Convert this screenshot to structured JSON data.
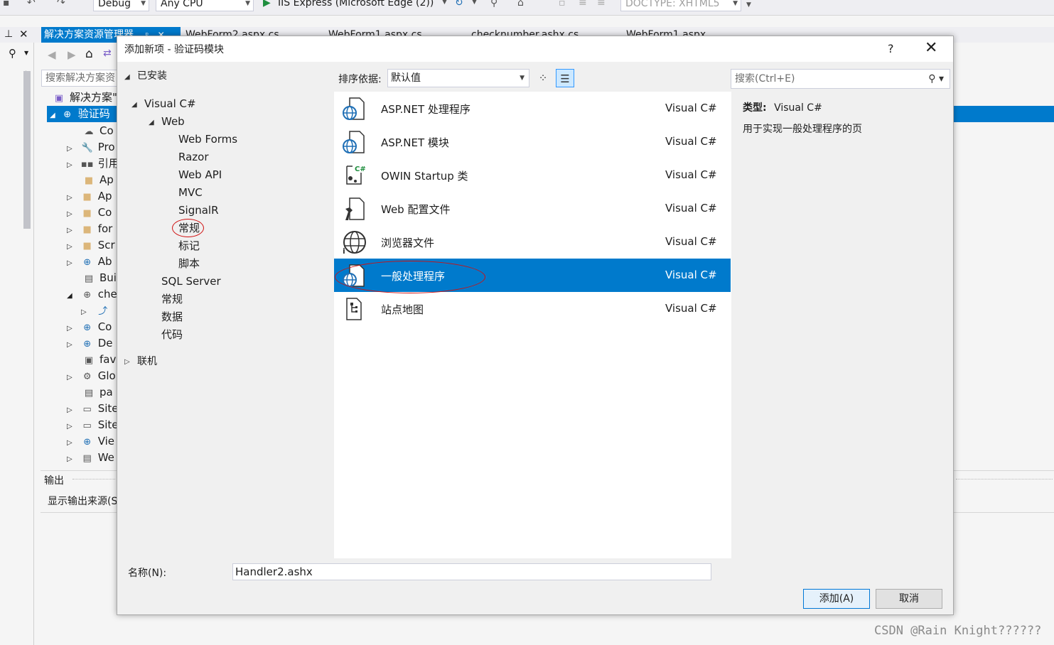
{
  "toolbar": {
    "config": "Debug",
    "platform": "Any CPU",
    "run_target": "IIS Express (Microsoft Edge (2))",
    "doctype": "DOCTYPE: XHTML5"
  },
  "doc_tabs": {
    "solution_explorer": "解决方案资源管理器",
    "tab1": "WebForm2.aspx.cs",
    "tab2": "WebForm1.aspx.cs",
    "tab3": "checknumber.ashx.cs",
    "tab4": "WebForm1.aspx"
  },
  "solution_explorer": {
    "search_placeholder": "搜索解决方案资",
    "solution_label": "解决方案\"",
    "project_label": "验证码",
    "items": [
      "Co",
      "Pro",
      "引用",
      "Ap",
      "Ap",
      "Co",
      "for",
      "Scr",
      "Ab",
      "Bui",
      "che",
      "",
      "Co",
      "De",
      "fav",
      "Glo",
      "pa",
      "Site",
      "Site",
      "Vie",
      "We"
    ]
  },
  "output": {
    "title": "输出",
    "source_label": "显示输出来源(S"
  },
  "dialog": {
    "title": "添加新项 - 验证码模块",
    "help": "?",
    "close": "✕",
    "tree": {
      "installed": "已安装",
      "visual_csharp": "Visual C#",
      "web": "Web",
      "web_forms": "Web Forms",
      "razor": "Razor",
      "web_api": "Web API",
      "mvc": "MVC",
      "signalr": "SignalR",
      "general_web": "常规",
      "markup": "标记",
      "script": "脚本",
      "sql_server": "SQL Server",
      "general": "常规",
      "data": "数据",
      "code": "代码",
      "online": "联机"
    },
    "sort_label": "排序依据:",
    "sort_value": "默认值",
    "search_placeholder": "搜索(Ctrl+E)",
    "templates": [
      {
        "name": "ASP.NET 处理程序",
        "lang": "Visual C#",
        "icon": "globe-doc-icon"
      },
      {
        "name": "ASP.NET 模块",
        "lang": "Visual C#",
        "icon": "globe-doc-icon"
      },
      {
        "name": "OWIN Startup 类",
        "lang": "Visual C#",
        "icon": "owin-class-icon"
      },
      {
        "name": "Web 配置文件",
        "lang": "Visual C#",
        "icon": "wrench-doc-icon"
      },
      {
        "name": "浏览器文件",
        "lang": "Visual C#",
        "icon": "globe-icon"
      },
      {
        "name": "一般处理程序",
        "lang": "Visual C#",
        "icon": "globe-doc-icon"
      },
      {
        "name": "站点地图",
        "lang": "Visual C#",
        "icon": "sitemap-icon"
      }
    ],
    "selected_index": 5,
    "detail": {
      "type_label": "类型:",
      "type_value": "Visual C#",
      "description": "用于实现一般处理程序的页"
    },
    "name_label": "名称(N):",
    "name_value": "Handler2.ashx",
    "add_button": "添加(A)",
    "cancel_button": "取消"
  },
  "watermark": "CSDN @Rain Knight??????",
  "colors": {
    "accent": "#007acc",
    "annotation_red": "#d01010"
  }
}
